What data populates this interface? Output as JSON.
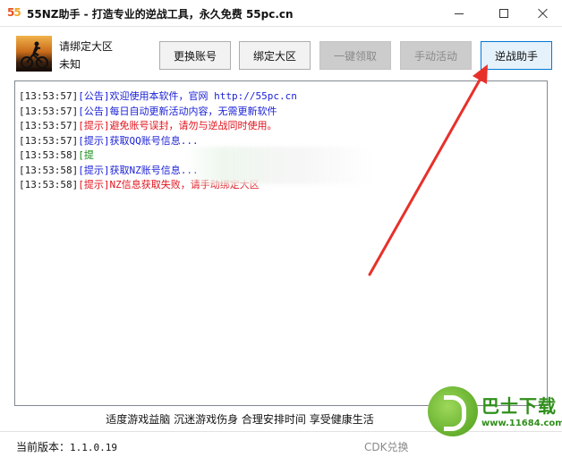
{
  "window": {
    "logo_part1": "5",
    "logo_part2": "5",
    "title": "55NZ助手 - 打造专业的逆战工具，永久免费  55pc.cn",
    "controls": [
      "minimize",
      "maximize",
      "close"
    ]
  },
  "account": {
    "line1": "请绑定大区",
    "line2": "未知",
    "avatar_icon": "cyclist-silhouette-avatar"
  },
  "toolbar": {
    "switch_account": "更换账号",
    "bind_region": "绑定大区",
    "one_click_claim": "一键领取",
    "manual_activity": "手动活动",
    "nz_assistant": "逆战助手"
  },
  "log": [
    {
      "time": "[13:53:57]",
      "tag": "[公告]",
      "msg": "欢迎使用本软件，官网 http://55pc.cn",
      "color": "#1c22d6"
    },
    {
      "time": "[13:53:57]",
      "tag": "[公告]",
      "msg": "每日自动更新活动内容，无需更新软件",
      "color": "#1c22d6"
    },
    {
      "time": "[13:53:57]",
      "tag": "[提示]",
      "msg": "避免账号误封，请勿与逆战同时使用。",
      "color": "#e0141e"
    },
    {
      "time": "[13:53:57]",
      "tag": "[提示]",
      "msg": "获取QQ账号信息...",
      "color": "#1c22d6"
    },
    {
      "time": "[13:53:58]",
      "tag": "[提",
      "msg": "",
      "color": "#1a8a1a"
    },
    {
      "time": "[13:53:58]",
      "tag": "[提示]",
      "msg": "获取NZ账号信息...",
      "color": "#1c22d6"
    },
    {
      "time": "[13:53:58]",
      "tag": "[提示]",
      "msg": "NZ信息获取失败，请手动绑定大区",
      "color": "#e0141e"
    }
  ],
  "slogan": "适度游戏益脑 沉迷游戏伤身 合理安排时间 享受健康生活",
  "status": {
    "version_label": "当前版本：",
    "version_value": "1.1.0.19",
    "cdk": "CDK兑换"
  },
  "watermark": {
    "text": "巴士下载",
    "url": "www.11684.com"
  },
  "annotation": {
    "arrow_color": "#e8302a"
  }
}
